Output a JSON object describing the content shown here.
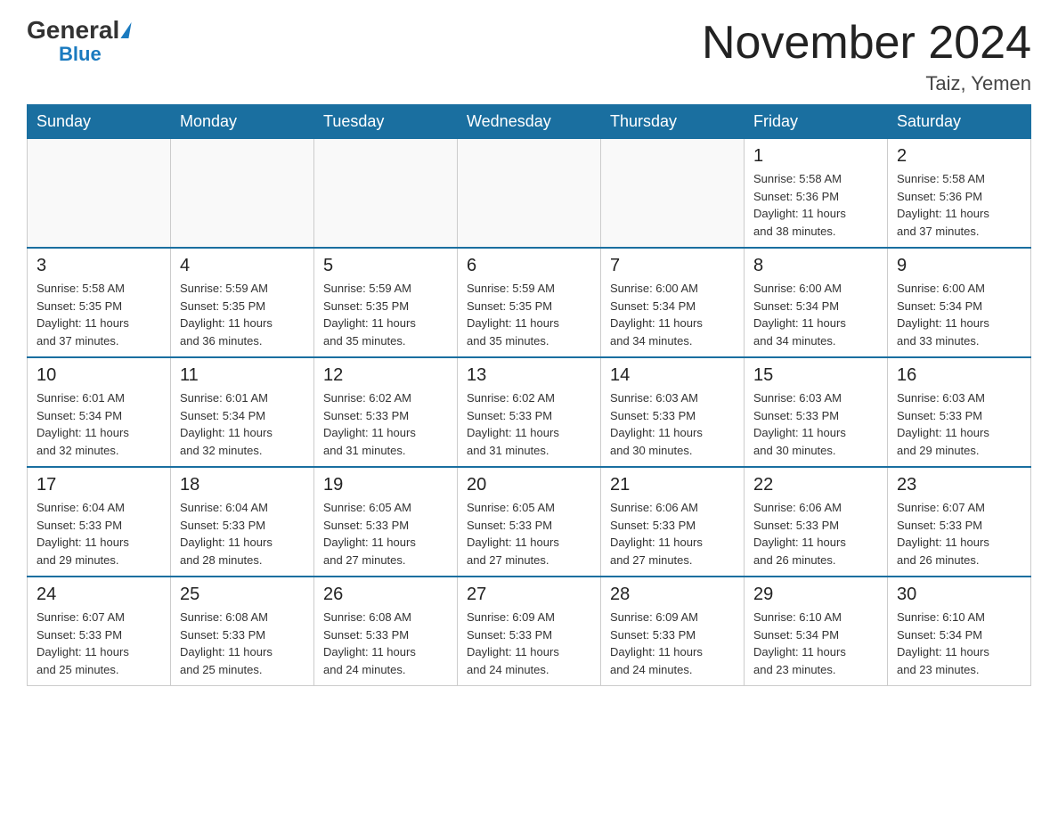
{
  "header": {
    "logo_general": "General",
    "logo_blue": "Blue",
    "title": "November 2024",
    "location": "Taiz, Yemen"
  },
  "weekdays": [
    "Sunday",
    "Monday",
    "Tuesday",
    "Wednesday",
    "Thursday",
    "Friday",
    "Saturday"
  ],
  "weeks": [
    [
      {
        "day": "",
        "info": ""
      },
      {
        "day": "",
        "info": ""
      },
      {
        "day": "",
        "info": ""
      },
      {
        "day": "",
        "info": ""
      },
      {
        "day": "",
        "info": ""
      },
      {
        "day": "1",
        "info": "Sunrise: 5:58 AM\nSunset: 5:36 PM\nDaylight: 11 hours\nand 38 minutes."
      },
      {
        "day": "2",
        "info": "Sunrise: 5:58 AM\nSunset: 5:36 PM\nDaylight: 11 hours\nand 37 minutes."
      }
    ],
    [
      {
        "day": "3",
        "info": "Sunrise: 5:58 AM\nSunset: 5:35 PM\nDaylight: 11 hours\nand 37 minutes."
      },
      {
        "day": "4",
        "info": "Sunrise: 5:59 AM\nSunset: 5:35 PM\nDaylight: 11 hours\nand 36 minutes."
      },
      {
        "day": "5",
        "info": "Sunrise: 5:59 AM\nSunset: 5:35 PM\nDaylight: 11 hours\nand 35 minutes."
      },
      {
        "day": "6",
        "info": "Sunrise: 5:59 AM\nSunset: 5:35 PM\nDaylight: 11 hours\nand 35 minutes."
      },
      {
        "day": "7",
        "info": "Sunrise: 6:00 AM\nSunset: 5:34 PM\nDaylight: 11 hours\nand 34 minutes."
      },
      {
        "day": "8",
        "info": "Sunrise: 6:00 AM\nSunset: 5:34 PM\nDaylight: 11 hours\nand 34 minutes."
      },
      {
        "day": "9",
        "info": "Sunrise: 6:00 AM\nSunset: 5:34 PM\nDaylight: 11 hours\nand 33 minutes."
      }
    ],
    [
      {
        "day": "10",
        "info": "Sunrise: 6:01 AM\nSunset: 5:34 PM\nDaylight: 11 hours\nand 32 minutes."
      },
      {
        "day": "11",
        "info": "Sunrise: 6:01 AM\nSunset: 5:34 PM\nDaylight: 11 hours\nand 32 minutes."
      },
      {
        "day": "12",
        "info": "Sunrise: 6:02 AM\nSunset: 5:33 PM\nDaylight: 11 hours\nand 31 minutes."
      },
      {
        "day": "13",
        "info": "Sunrise: 6:02 AM\nSunset: 5:33 PM\nDaylight: 11 hours\nand 31 minutes."
      },
      {
        "day": "14",
        "info": "Sunrise: 6:03 AM\nSunset: 5:33 PM\nDaylight: 11 hours\nand 30 minutes."
      },
      {
        "day": "15",
        "info": "Sunrise: 6:03 AM\nSunset: 5:33 PM\nDaylight: 11 hours\nand 30 minutes."
      },
      {
        "day": "16",
        "info": "Sunrise: 6:03 AM\nSunset: 5:33 PM\nDaylight: 11 hours\nand 29 minutes."
      }
    ],
    [
      {
        "day": "17",
        "info": "Sunrise: 6:04 AM\nSunset: 5:33 PM\nDaylight: 11 hours\nand 29 minutes."
      },
      {
        "day": "18",
        "info": "Sunrise: 6:04 AM\nSunset: 5:33 PM\nDaylight: 11 hours\nand 28 minutes."
      },
      {
        "day": "19",
        "info": "Sunrise: 6:05 AM\nSunset: 5:33 PM\nDaylight: 11 hours\nand 27 minutes."
      },
      {
        "day": "20",
        "info": "Sunrise: 6:05 AM\nSunset: 5:33 PM\nDaylight: 11 hours\nand 27 minutes."
      },
      {
        "day": "21",
        "info": "Sunrise: 6:06 AM\nSunset: 5:33 PM\nDaylight: 11 hours\nand 27 minutes."
      },
      {
        "day": "22",
        "info": "Sunrise: 6:06 AM\nSunset: 5:33 PM\nDaylight: 11 hours\nand 26 minutes."
      },
      {
        "day": "23",
        "info": "Sunrise: 6:07 AM\nSunset: 5:33 PM\nDaylight: 11 hours\nand 26 minutes."
      }
    ],
    [
      {
        "day": "24",
        "info": "Sunrise: 6:07 AM\nSunset: 5:33 PM\nDaylight: 11 hours\nand 25 minutes."
      },
      {
        "day": "25",
        "info": "Sunrise: 6:08 AM\nSunset: 5:33 PM\nDaylight: 11 hours\nand 25 minutes."
      },
      {
        "day": "26",
        "info": "Sunrise: 6:08 AM\nSunset: 5:33 PM\nDaylight: 11 hours\nand 24 minutes."
      },
      {
        "day": "27",
        "info": "Sunrise: 6:09 AM\nSunset: 5:33 PM\nDaylight: 11 hours\nand 24 minutes."
      },
      {
        "day": "28",
        "info": "Sunrise: 6:09 AM\nSunset: 5:33 PM\nDaylight: 11 hours\nand 24 minutes."
      },
      {
        "day": "29",
        "info": "Sunrise: 6:10 AM\nSunset: 5:34 PM\nDaylight: 11 hours\nand 23 minutes."
      },
      {
        "day": "30",
        "info": "Sunrise: 6:10 AM\nSunset: 5:34 PM\nDaylight: 11 hours\nand 23 minutes."
      }
    ]
  ]
}
